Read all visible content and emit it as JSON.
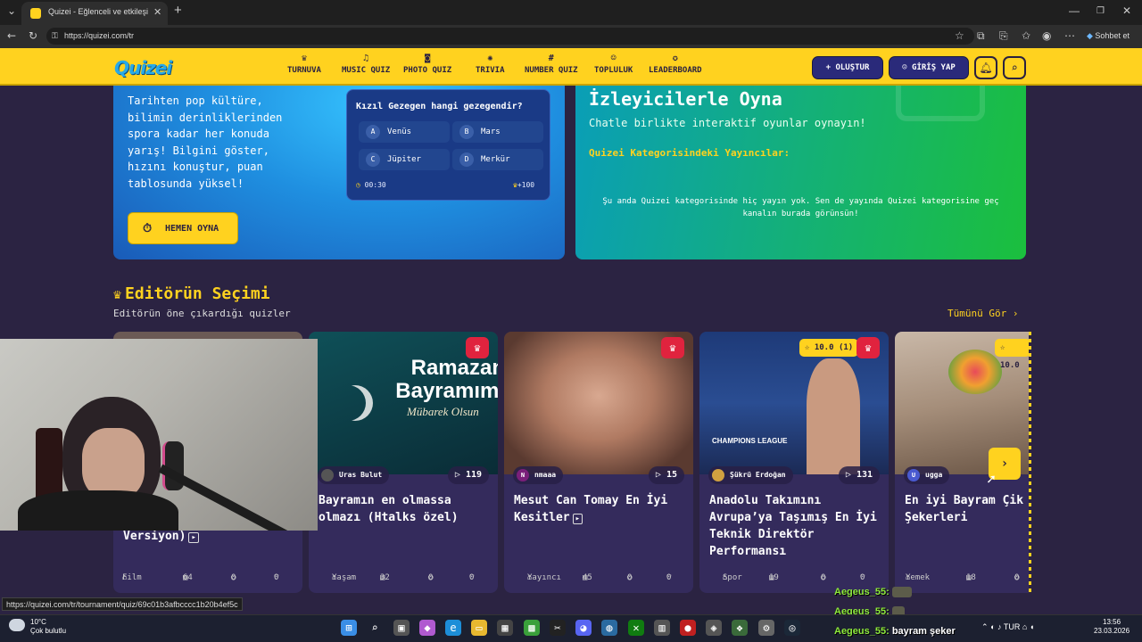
{
  "browser": {
    "tab_title": "Quizei - Eğlenceli ve etkileşimli qu",
    "url": "https://quizei.com/tr",
    "copilot_label": "Sohbet et"
  },
  "site": {
    "logo": "Quizei",
    "nav": [
      {
        "label": "TURNUVA",
        "icon": "trophy-icon"
      },
      {
        "label": "MUSIC QUIZ",
        "icon": "music-icon"
      },
      {
        "label": "PHOTO QUIZ",
        "icon": "camera-icon"
      },
      {
        "label": "TRIVIA",
        "icon": "bulb-icon"
      },
      {
        "label": "NUMBER QUIZ",
        "icon": "hash-icon"
      },
      {
        "label": "TOPLULUK",
        "icon": "users-icon"
      },
      {
        "label": "LEADERBOARD",
        "icon": "medal-icon"
      }
    ],
    "create_label": "OLUŞTUR",
    "login_label": "GİRİŞ YAP"
  },
  "hero_left": {
    "text": "Tarihten pop kültüre, bilimin derinliklerinden spora kadar her konuda yarış! Bilgini göster, hızını konuştur, puan tablosunda yüksel!",
    "play_label": "HEMEN OYNA",
    "question": "Kızıl Gezegen hangi gezegendir?",
    "options": [
      {
        "letter": "A",
        "text": "Venüs"
      },
      {
        "letter": "B",
        "text": "Mars"
      },
      {
        "letter": "C",
        "text": "Jüpiter"
      },
      {
        "letter": "D",
        "text": "Merkür"
      }
    ],
    "timer": "00:30",
    "points": "+100"
  },
  "hero_right": {
    "title": "İzleyicilerle Oyna",
    "subtitle": "Chatle birlikte interaktif oyunlar oynayın!",
    "category_label": "Quizei Kategorisindeki Yayıncılar:",
    "empty_text": "Şu anda Quizei kategorisinde hiç yayın yok. Sen de yayında Quizei kategorisine geç kanalın burada görünsün!"
  },
  "section": {
    "title": "Editörün Seçimi",
    "subtitle": "Editörün öne çıkardığı quizler",
    "see_all": "Tümünü Gör"
  },
  "cards": [
    {
      "title": "Versiyon)",
      "category": "Film",
      "questions": "64",
      "comments": "0",
      "likes": "0"
    },
    {
      "author": "Uras Bulut",
      "plays": "119",
      "title": "Bayramın en olmassa olmazı (Htalks özel)",
      "category": "Yaşam",
      "questions": "32",
      "comments": "0",
      "likes": "0",
      "thumb_text": "Ramazan Bayramımı",
      "thumb_sub": "Mübarek Olsun"
    },
    {
      "author": "nmaaa",
      "author_initial": "N",
      "plays": "15",
      "title": "Mesut Can Tomay En İyi Kesitler",
      "category": "Yayıncı",
      "questions": "45",
      "comments": "0",
      "likes": "0"
    },
    {
      "author": "Şükrü Erdoğan",
      "plays": "131",
      "rating": "10.0",
      "rating_count": "(1)",
      "title": "Anadolu Takımını Avrupa’ya Taşımış En İyi Teknik Direktör Performansı",
      "category": "Spor",
      "questions": "19",
      "comments": "0",
      "likes": "0",
      "thumb_text": "CHAMPIONS LEAGUE"
    },
    {
      "author": "ugga",
      "author_initial": "U",
      "rating": "10.0",
      "title": "En iyi Bayram Çik ve Şekerleri",
      "category": "Yemek",
      "questions": "18",
      "comments": "0"
    }
  ],
  "status_url": "https://quizei.com/tr/tournament/quiz/69c01b3afbcccc1b20b4ef5c",
  "chat": [
    {
      "user": "Aegeus_55:",
      "message": ""
    },
    {
      "user": "Aegeus_55:",
      "message": ""
    },
    {
      "user": "Aegeus_55:",
      "message": "bayram şeker"
    }
  ],
  "taskbar": {
    "weather_temp": "10°C",
    "weather_desc": "Çok bulutlu",
    "lang": "TUR",
    "time": "13:56",
    "date": "23.03.2026"
  },
  "colors": {
    "brand_yellow": "#ffd21f",
    "header_button": "#2a2a7a",
    "badge_red": "#e0233e",
    "chat_green": "#8eea3c"
  }
}
